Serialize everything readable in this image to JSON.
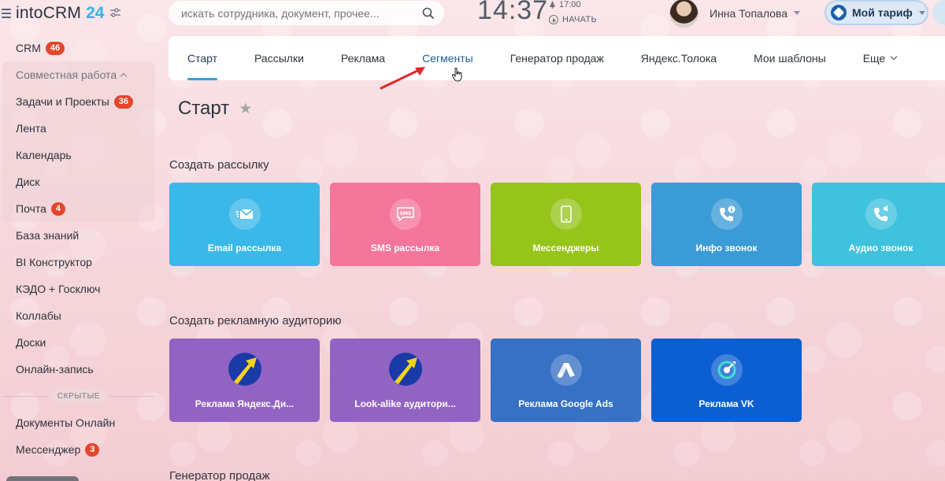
{
  "header": {
    "logo_text": "intoCRM",
    "logo_number": "24",
    "search_placeholder": "искать сотрудника, документ, прочее...",
    "time": "14:37",
    "alarm_time": "17:00",
    "start_label": "НАЧАТЬ",
    "user_name": "Инна Топалова",
    "tariff_label": "Мой тариф"
  },
  "sidebar": {
    "items": [
      {
        "label": "CRM",
        "badge": "46"
      },
      {
        "label": "Совместная работа",
        "group_head": true
      },
      {
        "label": "Задачи и Проекты",
        "badge": "36"
      },
      {
        "label": "Лента"
      },
      {
        "label": "Календарь"
      },
      {
        "label": "Диск"
      },
      {
        "label": "Почта",
        "badge": "4"
      },
      {
        "label": "База знаний"
      },
      {
        "label": "BI Конструктор"
      },
      {
        "label": "КЭДО + Госключ"
      },
      {
        "label": "Коллабы"
      },
      {
        "label": "Доски"
      },
      {
        "label": "Онлайн-запись"
      }
    ],
    "hidden_label": "СКРЫТЫЕ",
    "hidden_items": [
      {
        "label": "Документы Онлайн"
      },
      {
        "label": "Мессенджер",
        "badge": "3"
      }
    ]
  },
  "tabs": [
    {
      "label": "Старт",
      "active": true
    },
    {
      "label": "Рассылки"
    },
    {
      "label": "Реклама"
    },
    {
      "label": "Сегменты",
      "hovered": true
    },
    {
      "label": "Генератор продаж"
    },
    {
      "label": "Яндекс.Толока"
    },
    {
      "label": "Мои шаблоны"
    },
    {
      "label": "Еще"
    }
  ],
  "page": {
    "title": "Старт"
  },
  "sections": {
    "mailing": {
      "title": "Создать рассылку",
      "tiles": [
        {
          "label": "Email рассылка",
          "color": "#3bb8ea",
          "icon": "email-icon"
        },
        {
          "label": "SMS рассылка",
          "color": "#f4769a",
          "icon": "sms-icon"
        },
        {
          "label": "Мессенджеры",
          "color": "#97c41a",
          "icon": "phone-icon"
        },
        {
          "label": "Инфо звонок",
          "color": "#3a9bd6",
          "icon": "info-call-icon"
        },
        {
          "label": "Аудио звонок",
          "color": "#3ec2de",
          "icon": "audio-call-icon"
        }
      ]
    },
    "ads": {
      "title": "Создать рекламную аудиторию",
      "tiles": [
        {
          "label": "Реклама Яндекс.Ди...",
          "color": "#9164c3",
          "icon": "yandex-direct-icon"
        },
        {
          "label": "Look-alike аудитори...",
          "color": "#9164c3",
          "icon": "yandex-direct-icon"
        },
        {
          "label": "Реклама Google Ads",
          "color": "#3671c4",
          "icon": "google-ads-icon"
        },
        {
          "label": "Реклама VK",
          "color": "#0b5fd2",
          "icon": "vk-ads-icon"
        }
      ]
    },
    "sales": {
      "title": "Генератор продаж"
    }
  }
}
